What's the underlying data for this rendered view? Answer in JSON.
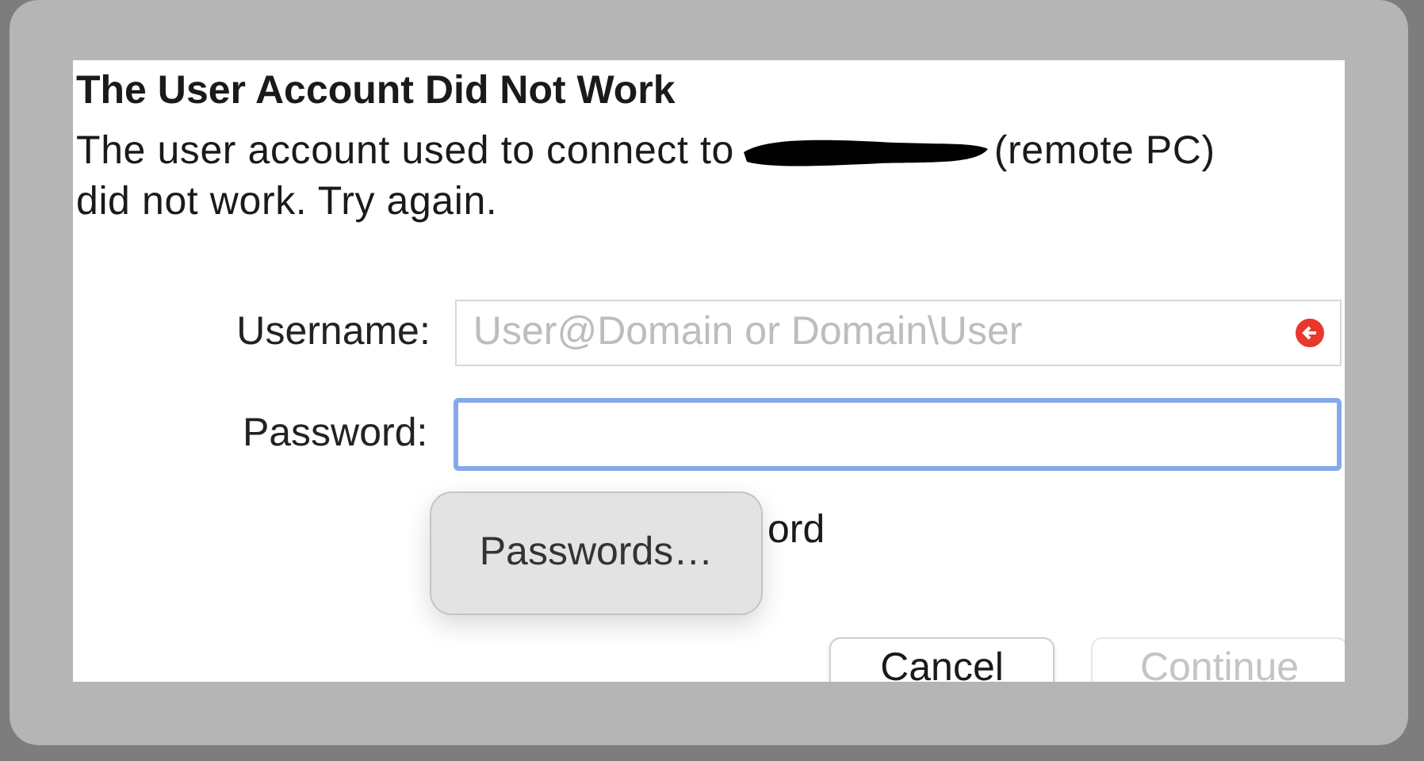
{
  "dialog": {
    "title": "The User Account Did Not Work",
    "message_before": "The user account used to connect to",
    "message_after": "(remote PC) did not work. Try again.",
    "fields": [
      {
        "label": "Username:",
        "placeholder": "User@Domain or Domain\\User",
        "focused": false,
        "error": true
      },
      {
        "label": "Password:",
        "focused": true,
        "error": false
      }
    ],
    "remember_label": "ord",
    "popup": {
      "label": "Passwords…"
    },
    "buttons": [
      {
        "label": "Cancel",
        "disabled": false
      },
      {
        "label": "Continue",
        "disabled": true
      }
    ]
  }
}
